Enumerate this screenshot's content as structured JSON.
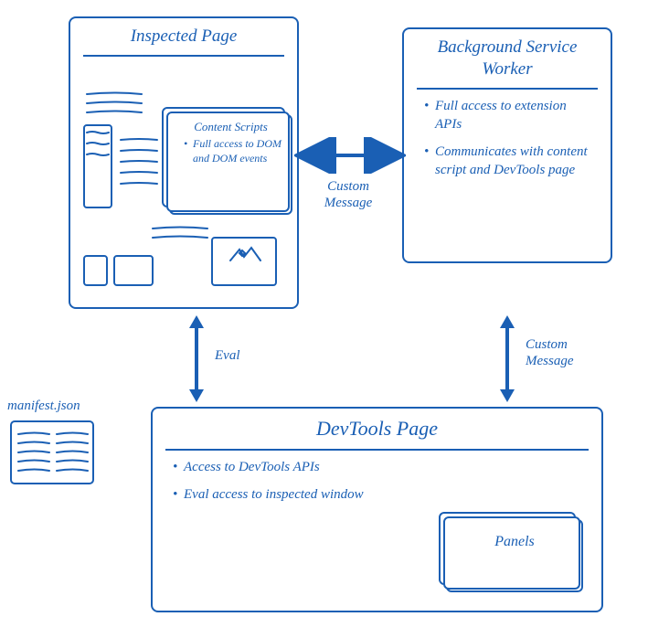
{
  "inspected": {
    "title": "Inspected Page",
    "content_scripts": {
      "title": "Content Scripts",
      "bullets": [
        "Full access to DOM and DOM events"
      ]
    }
  },
  "background": {
    "title": "Background Service Worker",
    "bullets": [
      "Full access to extension APIs",
      "Communicates with content script and DevTools page"
    ]
  },
  "devtools": {
    "title": "DevTools Page",
    "bullets": [
      "Access to DevTools APIs",
      "Eval access to inspected window"
    ],
    "panels_label": "Panels"
  },
  "manifest": {
    "label": "manifest.json"
  },
  "arrows": {
    "top_horizontal": "Custom Message",
    "left_vertical": "Eval",
    "right_vertical": "Custom Message"
  }
}
